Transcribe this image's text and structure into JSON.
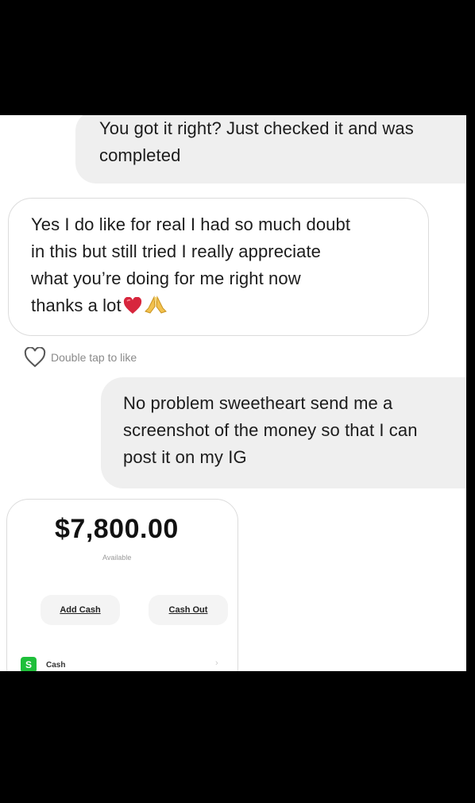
{
  "messages": {
    "sent1": {
      "line1": "You got it right? Just checked it and was",
      "line2": "completed"
    },
    "received1": {
      "line1": "Yes I do like for real I had so much doubt",
      "line2": "in this but still tried I really appreciate",
      "line3": "what you’re doing for me right now",
      "line4": "thanks a lot",
      "emojis": [
        "heart-emoji",
        "folded-hands-emoji"
      ]
    },
    "like_hint": "Double tap to like",
    "sent2": {
      "line1": "No problem sweetheart send me a",
      "line2": "screenshot of the money so that I can",
      "line3": "post it on my IG"
    }
  },
  "screenshot": {
    "balance": "$7,800.00",
    "balance_label": "Available",
    "add_cash": "Add Cash",
    "cash_out": "Cash Out",
    "row_icon": "S",
    "row_label": "Cash",
    "accent": "#1fbf3a"
  }
}
